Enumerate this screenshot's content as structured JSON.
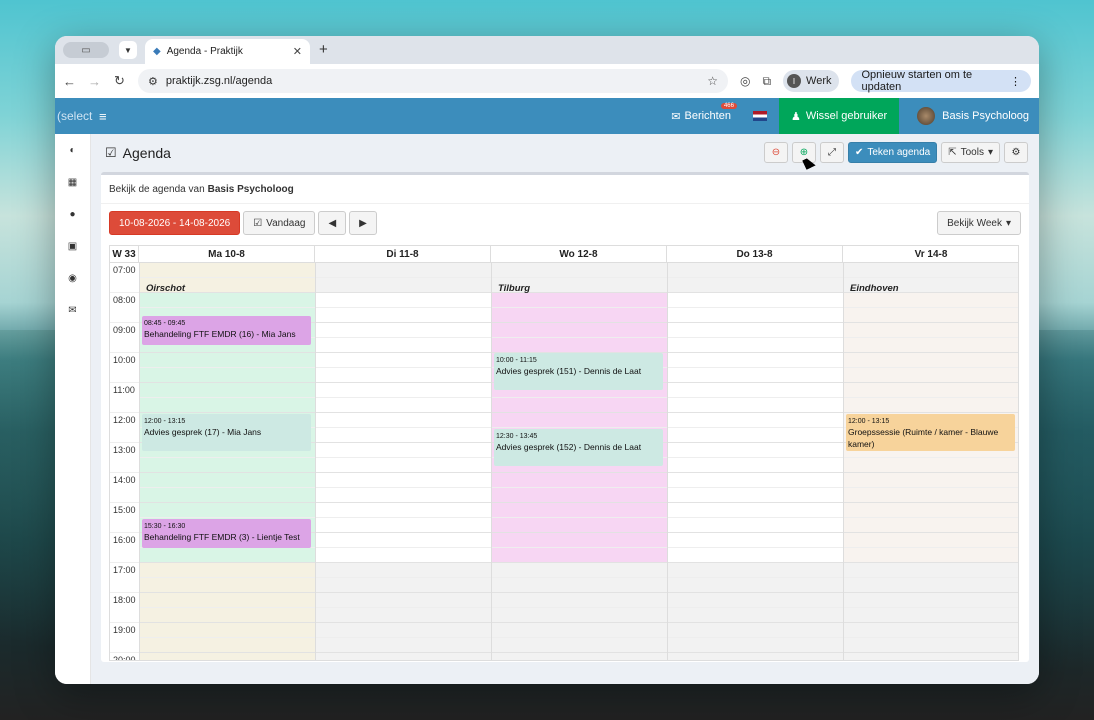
{
  "browser": {
    "tab_title": "Agenda - Praktijk",
    "url": "praktijk.zsg.nl/agenda",
    "profile_label": "Werk",
    "profile_initial": "I",
    "update_label": "Opnieuw starten om te updaten"
  },
  "app": {
    "brand": "(select",
    "messages_label": "Berichten",
    "messages_badge": "466",
    "switch_user_label": "Wissel gebruiker",
    "user_name": "Basis Psycholoog"
  },
  "page": {
    "title": "Agenda",
    "calendar_btn": "Teken agenda",
    "tools_btn": "Tools",
    "subtitle_prefix": "Bekijk de agenda van",
    "subtitle_user": "Basis Psycholoog",
    "date_range": "10-08-2026 - 14-08-2026",
    "today_btn": "Vandaag",
    "view_btn": "Bekijk Week"
  },
  "calendar": {
    "week_label": "W 33",
    "days": [
      "Ma 10-8",
      "Di 11-8",
      "Wo 12-8",
      "Do 13-8",
      "Vr 14-8"
    ],
    "hours": [
      "07:00",
      "08:00",
      "09:00",
      "10:00",
      "11:00",
      "12:00",
      "13:00",
      "14:00",
      "15:00",
      "16:00",
      "17:00",
      "18:00",
      "19:00",
      "20:00"
    ],
    "locations": {
      "mon": "Oirschot",
      "wed": "Tilburg",
      "fri": "Eindhoven"
    },
    "events": [
      {
        "time": "08:45 - 09:45",
        "title": "Behandeling FTF EMDR (16) - Mia Jans"
      },
      {
        "time": "12:00 - 13:15",
        "title": "Advies gesprek (17) - Mia Jans"
      },
      {
        "time": "15:30 - 16:30",
        "title": "Behandeling FTF EMDR (3) - Lientje Test"
      },
      {
        "time": "10:00 - 11:15",
        "title": "Advies gesprek (151) - Dennis de Laat"
      },
      {
        "time": "12:30 - 13:45",
        "title": "Advies gesprek (152) - Dennis de Laat"
      },
      {
        "time": "12:00 - 13:15",
        "title": "Groepssessie (Ruimte / kamer - Blauwe kamer)"
      }
    ]
  },
  "colors": {
    "navbar": "#3c8dbc",
    "switch": "#00a65a",
    "daterange": "#dd4b39",
    "mon_zone": "#d9f5e6",
    "wed_zone": "#f7d6f3",
    "fri_zone": "#f8f3ef",
    "emdr_event": "#dca4e6",
    "advice_event": "#cde9e3",
    "group_event": "#f7d39b"
  }
}
